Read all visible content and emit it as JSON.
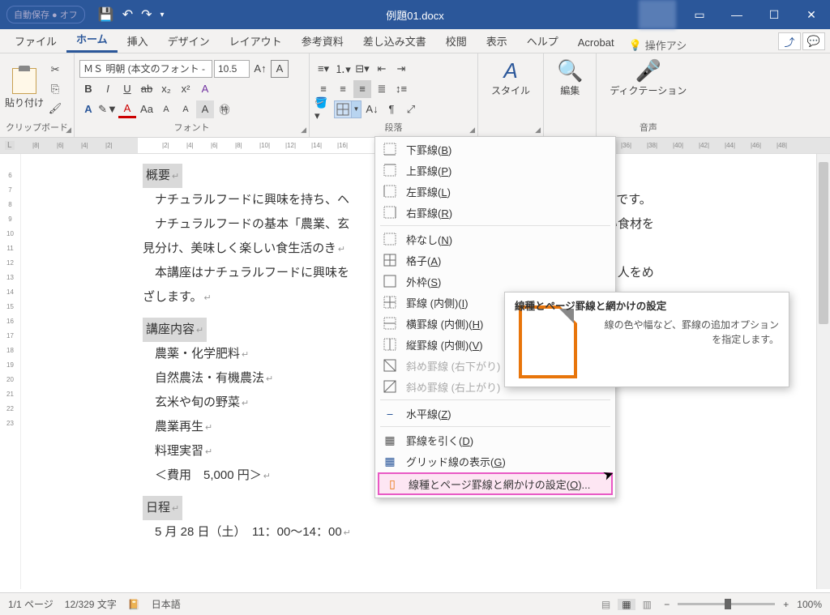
{
  "title": "例題01.docx",
  "autosave": "自動保存 ● オフ",
  "tabs": {
    "file": "ファイル",
    "home": "ホーム",
    "insert": "挿入",
    "design": "デザイン",
    "layout": "レイアウト",
    "references": "参考資料",
    "mailings": "差し込み文書",
    "review": "校閲",
    "view": "表示",
    "help": "ヘルプ",
    "acrobat": "Acrobat",
    "tellme": "操作アシ"
  },
  "ribbon": {
    "clipboard": {
      "label": "クリップボード",
      "paste": "貼り付け"
    },
    "font": {
      "label": "フォント",
      "name": "ＭＳ 明朝 (本文のフォント -",
      "size": "10.5"
    },
    "paragraph": {
      "label": "段落"
    },
    "styles": {
      "label": "スタイル",
      "btn": "スタイル"
    },
    "editing": {
      "label": "編集",
      "btn": "編集"
    },
    "voice": {
      "label": "音声",
      "btn": "ディクテーション"
    }
  },
  "borders_menu": {
    "bottom": "下罫線(B)",
    "top": "上罫線(P)",
    "left": "左罫線(L)",
    "right": "右罫線(R)",
    "none": "枠なし(N)",
    "all": "格子(A)",
    "box": "外枠(S)",
    "inside": "罫線 (内側)(I)",
    "inside_h": "横罫線 (内側)(H)",
    "inside_v": "縦罫線 (内側)(V)",
    "diag_down": "斜め罫線 (右下がり)",
    "diag_up": "斜め罫線 (右上がり)",
    "hline": "水平線(Z)",
    "draw": "罫線を引く(D)",
    "grid": "グリッド線の表示(G)",
    "settings": "線種とページ罫線と網かけの設定(O)..."
  },
  "tooltip": {
    "title": "線種とページ罫線と網かけの設定",
    "body": "線の色や幅など、罫線の追加オプションを指定します。"
  },
  "document": {
    "h1": "概要",
    "p1": "ナチュラルフードに興味を持ち、ヘ",
    "p1b": "ースです。",
    "p2a": "ナチュラルフードの基本「農業、玄",
    "p2b": "、よい食材を",
    "p3": "見分け、美味しく楽しい食生活のき",
    "p4a": "本講座はナチュラルフードに興味を",
    "p4b": "できる人をめ",
    "p5": "ざします。",
    "h2": "講座内容",
    "li1": "農薬・化学肥料",
    "li2": "自然農法・有機農法",
    "li3": "玄米や旬の野菜",
    "li4": "農業再生",
    "li5": "料理実習",
    "fee": "＜費用　5,000 円＞",
    "h3": "日程",
    "date": "5 月 28 日（土）　11：00～14：00"
  },
  "ruler_h": [
    "8",
    "6",
    "4",
    "2",
    "",
    "2",
    "4",
    "6",
    "8",
    "10",
    "12",
    "14",
    "16",
    "36",
    "38",
    "40",
    "42",
    "44",
    "46",
    "48"
  ],
  "ruler_v": [
    "",
    "6",
    "7",
    "8",
    "9",
    "10",
    "11",
    "12",
    "13",
    "14",
    "15",
    "16",
    "17",
    "18",
    "19",
    "20",
    "21",
    "22",
    "23"
  ],
  "status": {
    "page": "1/1 ページ",
    "words": "12/329 文字",
    "lang": "日本語",
    "zoom": "100%"
  }
}
